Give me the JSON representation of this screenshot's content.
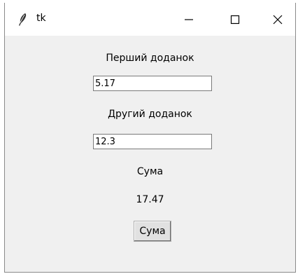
{
  "window": {
    "title": "tk"
  },
  "form": {
    "first_label": "Перший доданок",
    "first_value": "5.17",
    "second_label": "Другий доданок",
    "second_value": "12.3",
    "sum_label": "Сума",
    "sum_result": "17.47",
    "sum_button": "Сума"
  },
  "icons": {
    "app": "feather-icon",
    "minimize": "minimize-icon",
    "maximize": "maximize-icon",
    "close": "close-icon"
  }
}
